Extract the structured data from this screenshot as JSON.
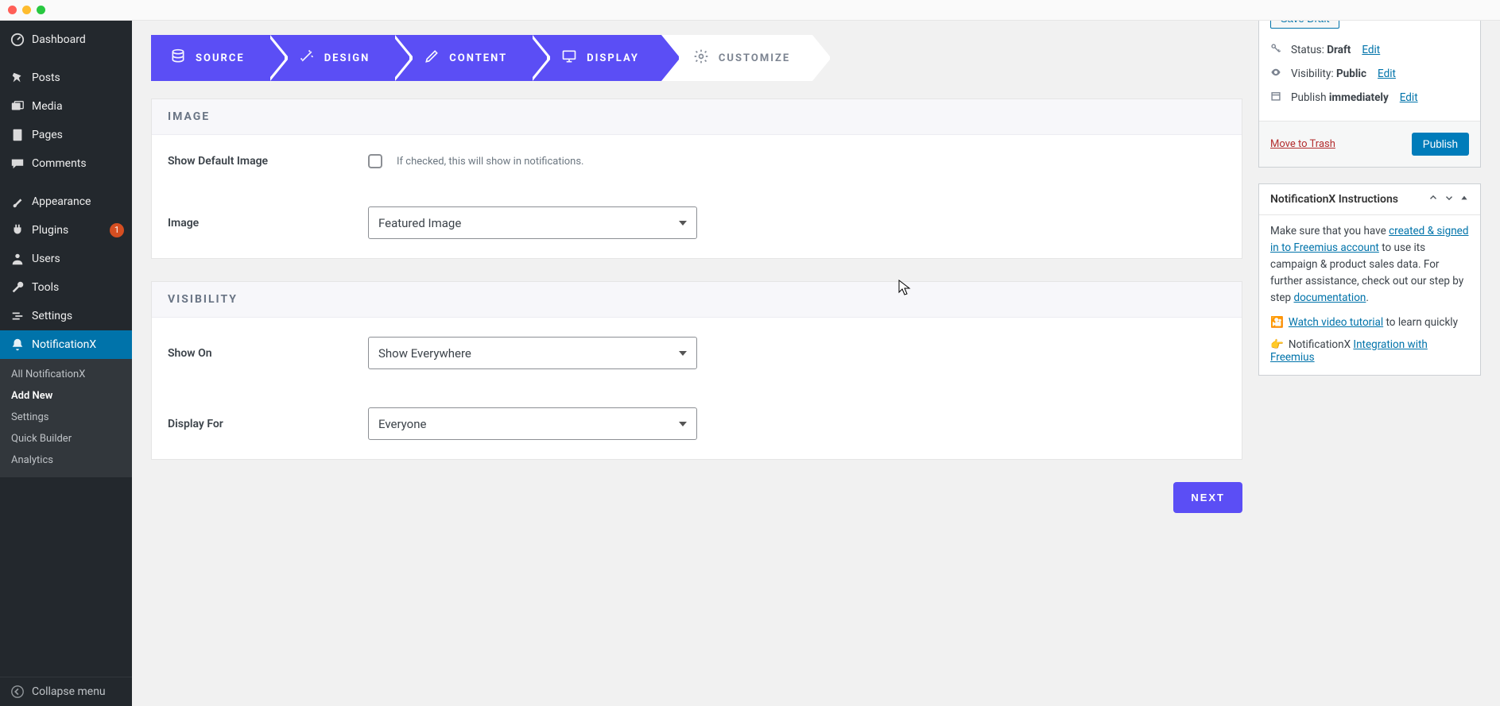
{
  "sidebar": {
    "dashboard": "Dashboard",
    "posts": "Posts",
    "media": "Media",
    "pages": "Pages",
    "comments": "Comments",
    "appearance": "Appearance",
    "plugins": "Plugins",
    "plugins_badge": "1",
    "users": "Users",
    "tools": "Tools",
    "settings": "Settings",
    "notificationx": "NotificationX",
    "collapse": "Collapse menu",
    "submenu": {
      "all": "All NotificationX",
      "add": "Add New",
      "settings": "Settings",
      "quick": "Quick Builder",
      "analytics": "Analytics"
    }
  },
  "steps": {
    "source": "SOURCE",
    "design": "DESIGN",
    "content": "CONTENT",
    "display": "DISPLAY",
    "customize": "CUSTOMIZE"
  },
  "image_section": {
    "title": "IMAGE",
    "show_default_label": "Show Default Image",
    "show_default_hint": "If checked, this will show in notifications.",
    "image_label": "Image",
    "image_value": "Featured Image"
  },
  "visibility_section": {
    "title": "VISIBILITY",
    "show_on_label": "Show On",
    "show_on_value": "Show Everywhere",
    "display_for_label": "Display For",
    "display_for_value": "Everyone"
  },
  "next_button": "NEXT",
  "publish_box": {
    "save_draft": "Save Draft",
    "status_label": "Status: ",
    "status_value": "Draft",
    "visibility_label": "Visibility: ",
    "visibility_value": "Public",
    "publish_label": "Publish ",
    "publish_value": "immediately",
    "edit": "Edit",
    "trash": "Move to Trash",
    "publish_btn": "Publish"
  },
  "instructions_box": {
    "title": "NotificationX Instructions",
    "intro_pre": "Make sure that you have ",
    "link1": "created & signed in to Freemius account",
    "intro_mid": " to use its campaign & product sales data. For further assistance, check out our step by step ",
    "link2": "documentation",
    "intro_end": ".",
    "watch_link": "Watch video tutorial",
    "watch_after": " to learn quickly",
    "integration_pre": "NotificationX ",
    "integration_link": "Integration with Freemius"
  }
}
